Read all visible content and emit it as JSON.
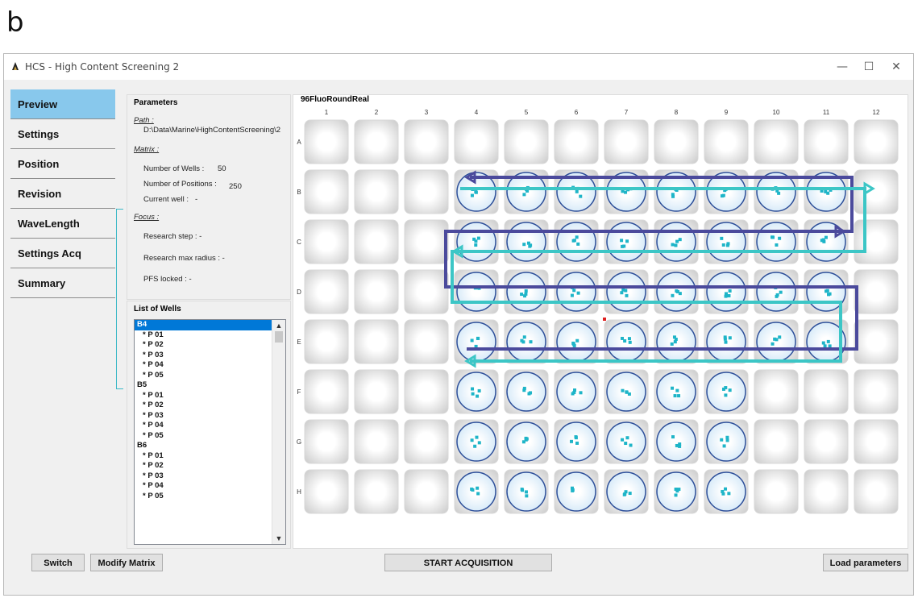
{
  "panel_letter": "b",
  "window": {
    "title": "HCS - High Content Screening 2",
    "controls": {
      "minimize": "—",
      "maximize": "☐",
      "close": "✕"
    }
  },
  "nav": {
    "items": [
      "Preview",
      "Settings",
      "Position",
      "Revision",
      "WaveLength",
      "Settings Acq",
      "Summary"
    ],
    "active": "Preview"
  },
  "parameters": {
    "title": "Parameters",
    "path_label": "Path :",
    "path_value": "D:\\Data\\Marine\\HighContentScreening\\2",
    "matrix_label": "Matrix :",
    "wells_label": "Number of Wells :",
    "wells_value": "50",
    "positions_label": "Number of Positions :",
    "positions_value": "250",
    "current_well_label": "Current well :",
    "current_well_value": "-",
    "focus_label": "Focus :",
    "research_step": "Research step :  -",
    "research_radius": "Research max radius :  -",
    "pfs_locked": "PFS locked :  -"
  },
  "list_of_wells": {
    "title": "List of Wells",
    "items": [
      {
        "text": "B4",
        "kind": "well",
        "selected": true
      },
      {
        "text": "* P 01",
        "kind": "pos"
      },
      {
        "text": "* P 02",
        "kind": "pos"
      },
      {
        "text": "* P 03",
        "kind": "pos"
      },
      {
        "text": "* P 04",
        "kind": "pos"
      },
      {
        "text": "* P 05",
        "kind": "pos"
      },
      {
        "text": "B5",
        "kind": "well"
      },
      {
        "text": "* P 01",
        "kind": "pos"
      },
      {
        "text": "* P 02",
        "kind": "pos"
      },
      {
        "text": "* P 03",
        "kind": "pos"
      },
      {
        "text": "* P 04",
        "kind": "pos"
      },
      {
        "text": "* P 05",
        "kind": "pos"
      },
      {
        "text": "B6",
        "kind": "well"
      },
      {
        "text": "* P 01",
        "kind": "pos"
      },
      {
        "text": "* P 02",
        "kind": "pos"
      },
      {
        "text": "* P 03",
        "kind": "pos"
      },
      {
        "text": "* P 04",
        "kind": "pos"
      },
      {
        "text": "* P 05",
        "kind": "pos"
      }
    ],
    "scroll_up": "▲",
    "scroll_down": "▼"
  },
  "plate": {
    "title": "96FluoRoundReal",
    "columns": [
      "1",
      "2",
      "3",
      "4",
      "5",
      "6",
      "7",
      "8",
      "9",
      "10",
      "11",
      "12"
    ],
    "rows": [
      "A",
      "B",
      "C",
      "D",
      "E",
      "F",
      "G",
      "H"
    ],
    "selected_wells": {
      "B": [
        4,
        5,
        6,
        7,
        8,
        9,
        10,
        11
      ],
      "C": [
        4,
        5,
        6,
        7,
        8,
        9,
        10,
        11
      ],
      "D": [
        4,
        5,
        6,
        7,
        8,
        9,
        10,
        11
      ],
      "E": [
        4,
        5,
        6,
        7,
        8,
        9,
        10,
        11
      ],
      "F": [
        4,
        5,
        6,
        7,
        8,
        9
      ],
      "G": [
        4,
        5,
        6,
        7,
        8,
        9
      ],
      "H": [
        4,
        5,
        6,
        7,
        8,
        9
      ]
    },
    "well_color": "#cfe6f7",
    "position_dot_color": "#1fb5c8",
    "path_color_dark": "#4b4a9c",
    "path_color_light": "#3cc6c6"
  },
  "buttons": {
    "switch": "Switch",
    "modify_matrix": "Modify Matrix",
    "start": "START ACQUISITION",
    "load": "Load parameters"
  }
}
